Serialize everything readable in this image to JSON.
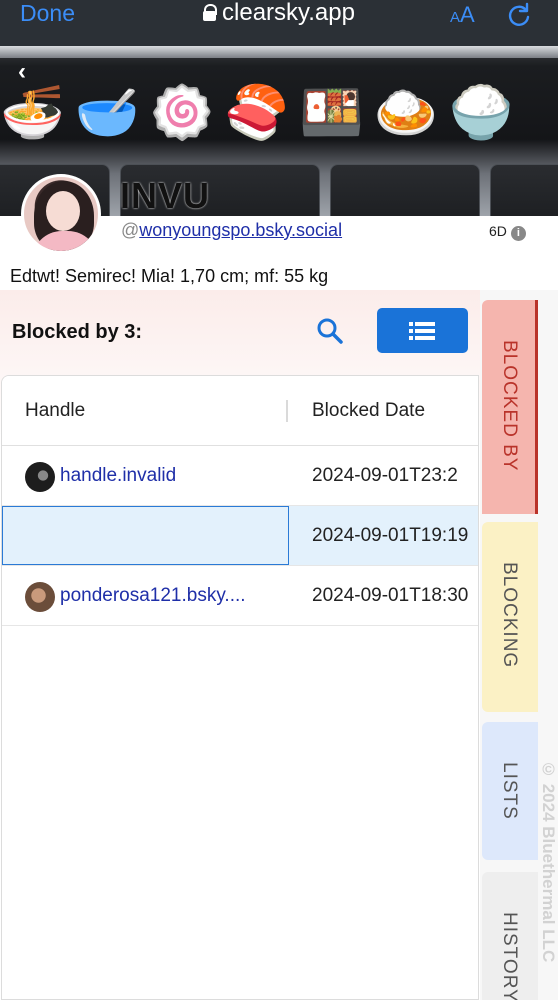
{
  "browser": {
    "done_label": "Done",
    "url": "clearsky.app",
    "text_size_small": "A",
    "text_size_large": "A"
  },
  "banner": {
    "emojis": "🍜🥣🍥🍣🍱🍛🍚"
  },
  "profile": {
    "display_name": "INVU",
    "handle_prefix": "@",
    "handle": "wonyoungspo.bsky.social",
    "age": "6D",
    "info_glyph": "i",
    "bio": "Edtwt! Semirec! Mia! 1,70 cm; mf: 55 kg"
  },
  "blocked": {
    "title": "Blocked by 3:",
    "columns": [
      "Handle",
      "Blocked Date"
    ],
    "rows": [
      {
        "handle": "handle.invalid",
        "date": "2024-09-01T23:2",
        "has_avatar": true,
        "selected": false
      },
      {
        "handle": "",
        "date": "2024-09-01T19:19",
        "has_avatar": false,
        "selected": true
      },
      {
        "handle": "ponderosa121.bsky....",
        "date": "2024-09-01T18:30",
        "has_avatar": true,
        "selected": false
      }
    ]
  },
  "tabs": {
    "blocked_by": "BLOCKED BY",
    "blocking": "BLOCKING",
    "lists": "LISTS",
    "history": "HISTORY"
  },
  "footer": {
    "copyright": "© 2024 Bluethermal LLC"
  },
  "colors": {
    "accent": "#1a73d8",
    "link": "#1f2fa8",
    "blocked_tab": "#f5b5ae",
    "blocking_tab": "#fbf1c5",
    "lists_tab": "#dde8fb",
    "history_tab": "#eeeeee"
  }
}
